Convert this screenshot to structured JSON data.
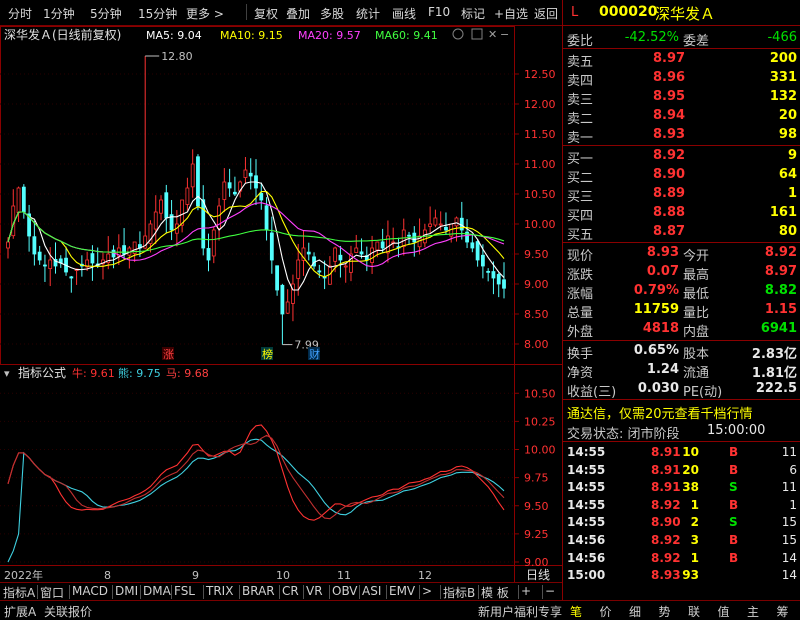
{
  "menu": {
    "items": [
      "分时",
      "1分钟",
      "5分钟",
      "15分钟",
      "更多 >",
      "复权",
      "叠加",
      "多股",
      "统计",
      "画线",
      "F10",
      "标记",
      "+自选",
      "返回"
    ]
  },
  "stock": {
    "flag": "L",
    "code": "000020",
    "name": "深华发Ａ"
  },
  "chart_header": {
    "title": "深华发Ａ(日线前复权)",
    "ma5": "MA5: 9.04",
    "ma10": "MA10: 9.15",
    "ma20": "MA20: 9.57",
    "ma60": "MA60: 9.41"
  },
  "indicator_header": {
    "title": "指标公式",
    "niu": "牛: 9.61",
    "xiong": "熊: 9.75",
    "ma": "马: 9.68"
  },
  "price_axis": [
    "12.50",
    "12.00",
    "11.50",
    "11.00",
    "10.50",
    "10.00",
    "9.50",
    "9.00",
    "8.50",
    "8.00"
  ],
  "indicator_axis": [
    "10.50",
    "10.25",
    "10.00",
    "9.75",
    "9.50",
    "9.25",
    "9.00"
  ],
  "annotations": {
    "high": "12.80",
    "low": "7.99",
    "mark_zhang": "涨",
    "mark_bang": "榜",
    "mark_cai": "财"
  },
  "date_axis": {
    "labels": [
      "2022年",
      "8",
      "9",
      "10",
      "11",
      "12"
    ],
    "period": "日线"
  },
  "order_book": {
    "weibi_label": "委比",
    "weibi_value": "-42.52%",
    "weicha_label": "委差",
    "weicha_value": "-466",
    "sells": [
      {
        "label": "卖五",
        "price": "8.97",
        "vol": "200"
      },
      {
        "label": "卖四",
        "price": "8.96",
        "vol": "331"
      },
      {
        "label": "卖三",
        "price": "8.95",
        "vol": "132"
      },
      {
        "label": "卖二",
        "price": "8.94",
        "vol": "20"
      },
      {
        "label": "卖一",
        "price": "8.93",
        "vol": "98"
      }
    ],
    "buys": [
      {
        "label": "买一",
        "price": "8.92",
        "vol": "9"
      },
      {
        "label": "买二",
        "price": "8.90",
        "vol": "64"
      },
      {
        "label": "买三",
        "price": "8.89",
        "vol": "1"
      },
      {
        "label": "买四",
        "price": "8.88",
        "vol": "161"
      },
      {
        "label": "买五",
        "price": "8.87",
        "vol": "80"
      }
    ]
  },
  "quote": [
    {
      "l1": "现价",
      "v1": "8.93",
      "l2": "今开",
      "v2": "8.92"
    },
    {
      "l1": "涨跌",
      "v1": "0.07",
      "l2": "最高",
      "v2": "8.97"
    },
    {
      "l1": "涨幅",
      "v1": "0.79%",
      "l2": "最低",
      "v2": "8.82"
    },
    {
      "l1": "总量",
      "v1": "11759",
      "l2": "量比",
      "v2": "1.15"
    },
    {
      "l1": "外盘",
      "v1": "4818",
      "l2": "内盘",
      "v2": "6941"
    }
  ],
  "fundamentals": [
    {
      "l1": "换手",
      "v1": "0.65%",
      "l2": "股本",
      "v2": "2.83亿"
    },
    {
      "l1": "净资",
      "v1": "1.24",
      "l2": "流通",
      "v2": "1.81亿"
    },
    {
      "l1": "收益(三)",
      "v1": "0.030",
      "l2": "PE(动)",
      "v2": "222.5"
    }
  ],
  "promo": "通达信，仅需20元查看千档行情",
  "trade_status": {
    "label": "交易状态: 闭市阶段",
    "time": "15:00:00"
  },
  "trades": [
    {
      "t": "14:55",
      "p": "8.91",
      "v": "10",
      "d": "B"
    },
    {
      "t": "14:55",
      "p": "8.91",
      "v": "20",
      "d": "B"
    },
    {
      "t": "14:55",
      "p": "8.91",
      "v": "38",
      "d": "S"
    },
    {
      "t": "14:55",
      "p": "8.92",
      "v": "1",
      "d": "B"
    },
    {
      "t": "14:55",
      "p": "8.90",
      "v": "2",
      "d": "S"
    },
    {
      "t": "14:56",
      "p": "8.92",
      "v": "3",
      "d": "B"
    },
    {
      "t": "14:56",
      "p": "8.92",
      "v": "1",
      "d": "B"
    },
    {
      "t": "15:00",
      "p": "8.93",
      "v": "93",
      "d": ""
    }
  ],
  "trade_counts": [
    "11",
    "6",
    "11",
    "1",
    "15",
    "15",
    "14",
    "14"
  ],
  "tabs": [
    "指标A",
    "窗口",
    "MACD",
    "DMI",
    "DMA",
    "FSL",
    "TRIX",
    "BRAR",
    "CR",
    "VR",
    "OBV",
    "ASI",
    "EMV",
    ">",
    "指标B",
    "模 板",
    "+",
    "−"
  ],
  "status": {
    "left": [
      "扩展A",
      "关联报价"
    ],
    "promo": "新用户福利专享",
    "right_tabs": [
      "笔",
      "价",
      "细",
      "势",
      "联",
      "值",
      "主",
      "筹"
    ]
  },
  "chart_data": {
    "type": "candlestick",
    "title": "深华发Ａ(日线前复权)",
    "price_range": [
      7.8,
      13.0
    ],
    "x_months": [
      "2022年",
      "8",
      "9",
      "10",
      "11",
      "12"
    ],
    "ma": {
      "MA5": 9.04,
      "MA10": 9.15,
      "MA20": 9.57,
      "MA60": 9.41
    },
    "high_mark": 12.8,
    "low_mark": 7.99,
    "closes": [
      9.7,
      10.3,
      10.6,
      10.2,
      9.8,
      9.5,
      9.4,
      9.3,
      9.4,
      9.3,
      9.35,
      9.2,
      9.1,
      9.25,
      9.3,
      9.4,
      9.35,
      9.3,
      9.4,
      9.5,
      9.45,
      9.6,
      9.5,
      9.6,
      9.7,
      9.6,
      9.8,
      10.0,
      10.2,
      10.4,
      10.1,
      9.9,
      10.0,
      10.4,
      10.6,
      11.0,
      10.3,
      9.6,
      9.4,
      9.9,
      10.3,
      10.7,
      10.6,
      10.5,
      10.7,
      10.9,
      10.8,
      10.6,
      10.4,
      9.9,
      9.4,
      8.9,
      8.5,
      8.7,
      9.0,
      9.4,
      9.6,
      9.5,
      9.3,
      9.2,
      9.1,
      9.3,
      9.6,
      9.4,
      9.3,
      9.5,
      9.6,
      9.5,
      9.4,
      9.6,
      9.7,
      9.6,
      9.8,
      9.7,
      9.6,
      9.9,
      9.8,
      9.7,
      9.8,
      9.9,
      10.0,
      10.1,
      10.0,
      9.9,
      10.0,
      10.1,
      9.9,
      9.7,
      9.6,
      9.4,
      9.3,
      9.2,
      9.1,
      9.0,
      8.93
    ],
    "indicator": {
      "title": "指标公式",
      "range": [
        9.0,
        10.6
      ],
      "series": [
        {
          "name": "牛",
          "color": "#ff3232",
          "last": 9.61
        },
        {
          "name": "熊",
          "color": "#3fd0e0",
          "last": 9.75
        },
        {
          "name": "马",
          "color": "#ff4040",
          "last": 9.68
        }
      ]
    }
  }
}
